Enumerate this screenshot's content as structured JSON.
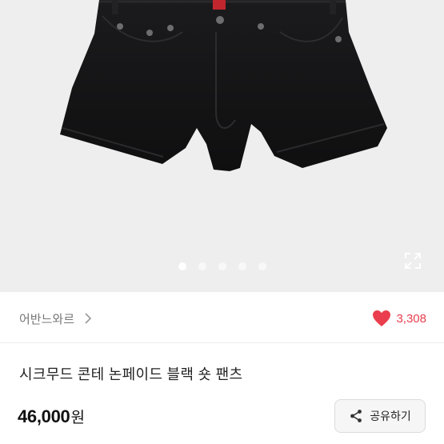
{
  "gallery": {
    "image_subject": "black denim short pants",
    "current_index": 1,
    "total_images": 5,
    "expand_icon": "expand-icon"
  },
  "seller": {
    "name": "어반느와르",
    "chevron_icon": "chevron-right-icon"
  },
  "likes": {
    "icon": "heart-icon",
    "count": "3,308",
    "color": "#ea3e4e"
  },
  "product": {
    "title": "시크무드 콘테 논페이드 블랙 숏 팬츠",
    "price": "46,000",
    "price_unit": "원"
  },
  "share": {
    "label": "공유하기",
    "icon": "share-icon"
  }
}
